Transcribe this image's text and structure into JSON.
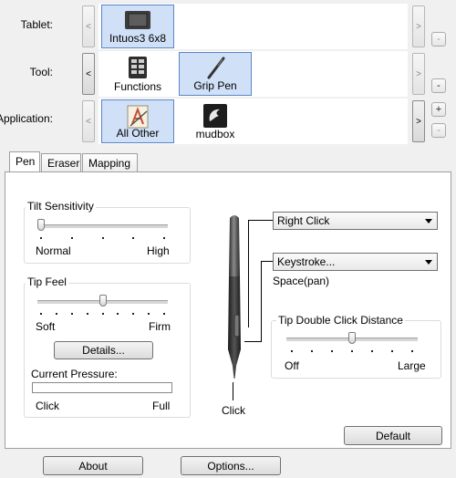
{
  "top": {
    "tablet": {
      "label": "Tablet:",
      "items": [
        {
          "name": "Intuos3 6x8",
          "icon": "tablet-icon",
          "selected": true
        }
      ]
    },
    "tool": {
      "label": "Tool:",
      "items": [
        {
          "name": "Functions",
          "icon": "functions-icon",
          "selected": false
        },
        {
          "name": "Grip Pen",
          "icon": "pen-icon",
          "selected": true
        }
      ]
    },
    "application": {
      "label": "Application:",
      "items": [
        {
          "name": "All Other",
          "icon": "all-other-icon",
          "selected": true
        },
        {
          "name": "mudbox",
          "icon": "mudbox-icon",
          "selected": false
        }
      ]
    },
    "nav": {
      "left": "<",
      "right": ">",
      "add": "+",
      "remove": "-"
    }
  },
  "tabs": {
    "pen": "Pen",
    "eraser": "Eraser",
    "mapping": "Mapping",
    "active": "Pen"
  },
  "tilt": {
    "title": "Tilt Sensitivity",
    "min_label": "Normal",
    "max_label": "High",
    "value_fraction": 0.0,
    "ticks": 5
  },
  "tip_feel": {
    "title": "Tip Feel",
    "min_label": "Soft",
    "max_label": "Firm",
    "value_fraction": 0.5,
    "ticks": 9,
    "details_button": "Details...",
    "pressure_label": "Current Pressure:",
    "pressure_min": "Click",
    "pressure_max": "Full",
    "pressure_fraction": 0.0
  },
  "buttons": {
    "upper": "Right Click",
    "lower": "Keystroke...",
    "lower_sub": "Space(pan)"
  },
  "pen_tip_label": "Click",
  "double_click": {
    "title": "Tip Double Click Distance",
    "min_label": "Off",
    "max_label": "Large",
    "value_fraction": 0.5,
    "ticks": 7
  },
  "footer": {
    "default": "Default",
    "about": "About",
    "options": "Options..."
  },
  "colors": {
    "selection_bg": "#cfe0f7",
    "selection_border": "#5a86c6"
  }
}
